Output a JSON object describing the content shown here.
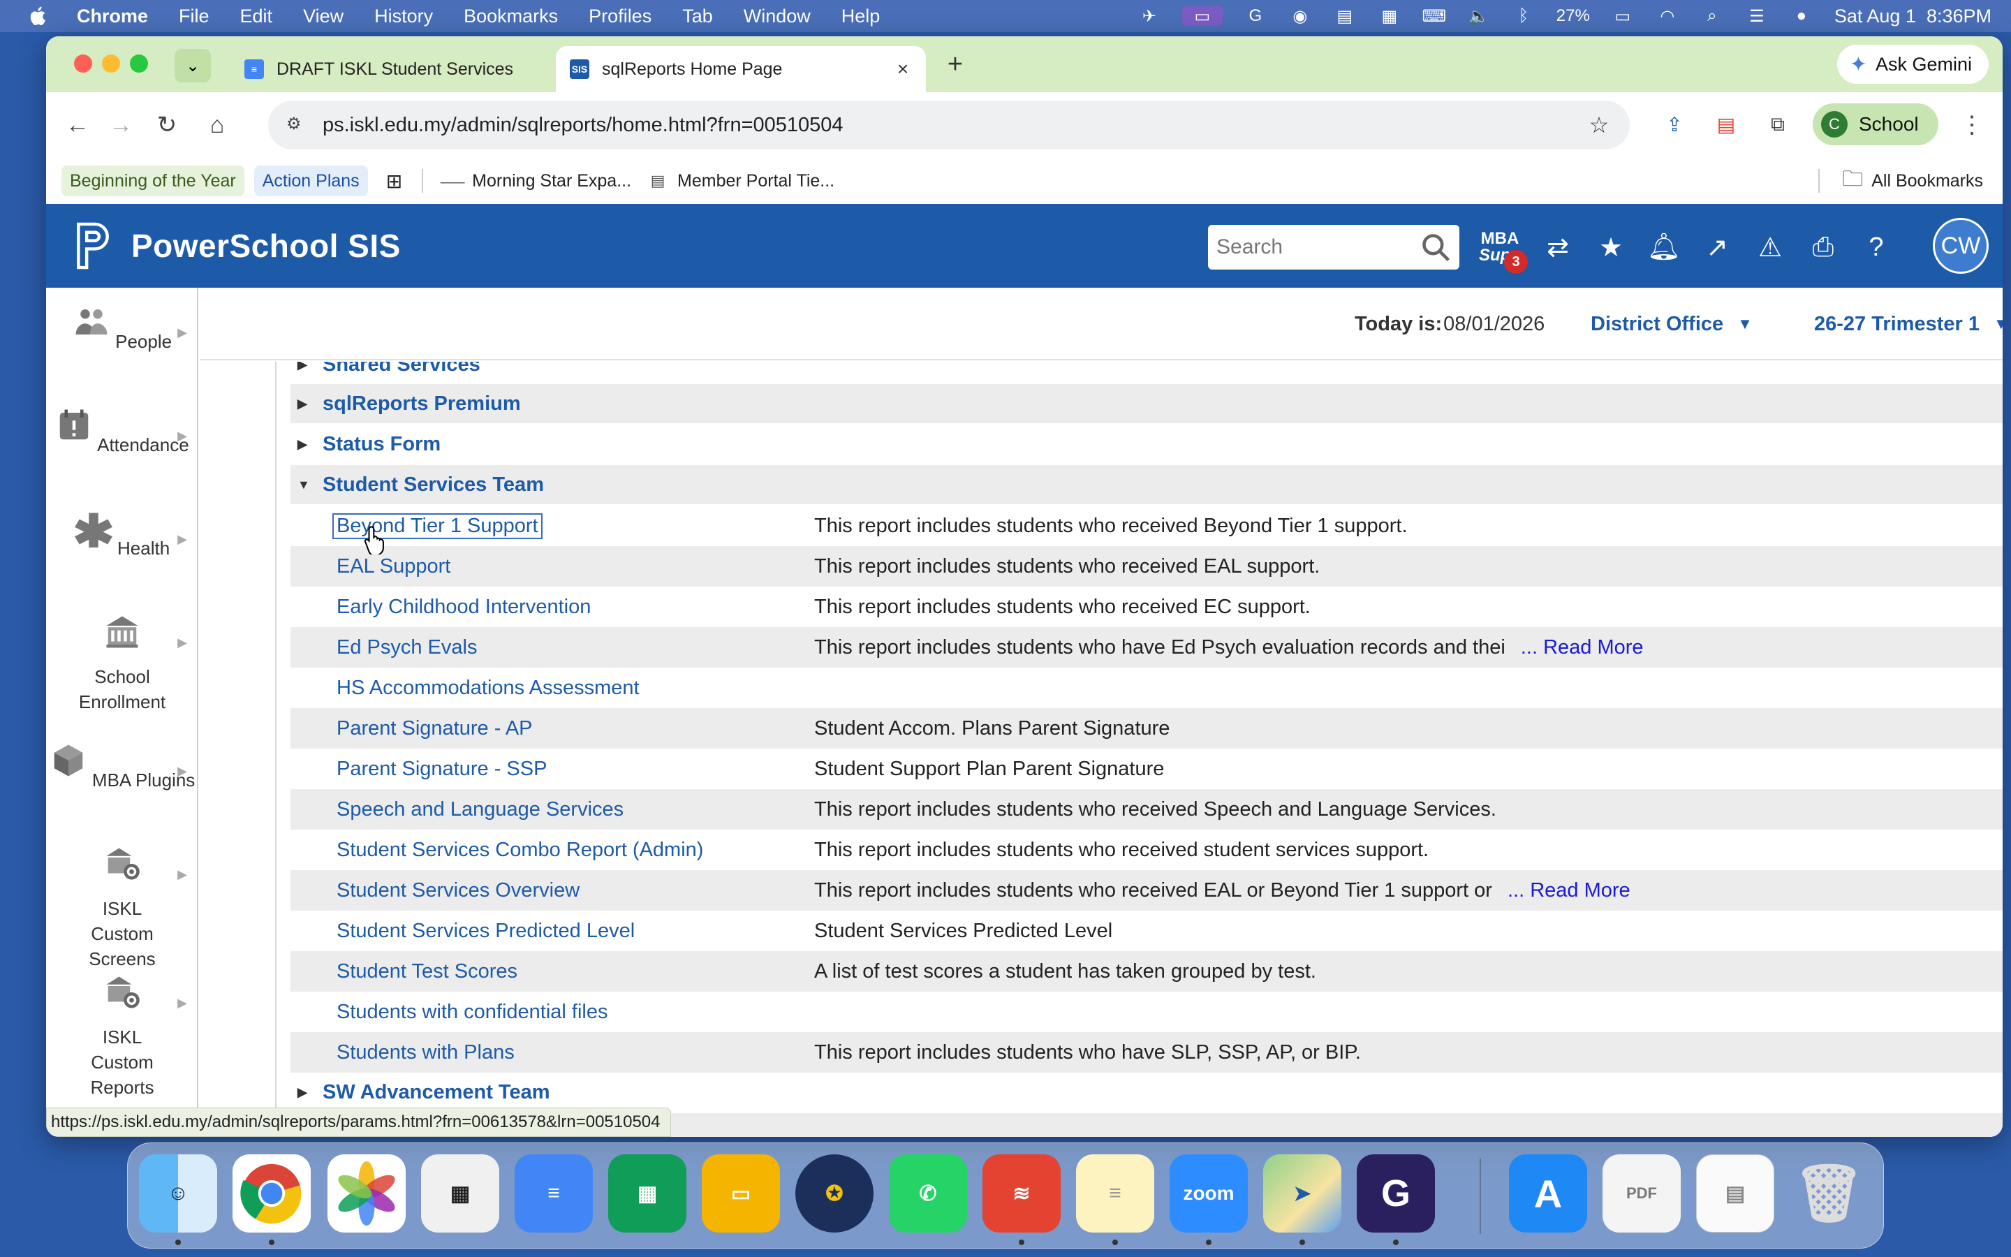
{
  "menubar": {
    "app": "Chrome",
    "items": [
      "File",
      "Edit",
      "View",
      "History",
      "Bookmarks",
      "Profiles",
      "Tab",
      "Window",
      "Help"
    ],
    "battery": "27%",
    "datetime": "Sat Aug 1  8:36PM"
  },
  "browser": {
    "tabs": [
      {
        "title": "DRAFT ISKL Student Services",
        "active": false
      },
      {
        "title": "sqlReports Home Page",
        "active": true
      }
    ],
    "ask_gemini": "Ask Gemini",
    "url": "ps.iskl.edu.my/admin/sqlreports/home.html?frn=00510504",
    "profile_initial": "C",
    "profile_label": "School",
    "bookmarks": [
      "Beginning of the Year",
      "Action Plans",
      "Morning Star Expa...",
      "Member Portal Tie..."
    ],
    "all_bookmarks": "All Bookmarks",
    "status_url": "https://ps.iskl.edu.my/admin/sqlreports/params.html?frn=00613578&lrn=00510504"
  },
  "app": {
    "title": "PowerSchool SIS",
    "search_placeholder": "Search",
    "mba_label_1": "MBA",
    "mba_label_2": "Supp",
    "mba_badge": "3",
    "avatar_initials": "CW",
    "today_label": "Today is:",
    "today_value": "08/01/2026",
    "school": "District Office",
    "term": "26-27 Trimester 1"
  },
  "nav": [
    {
      "label": "People"
    },
    {
      "label": "Attendance"
    },
    {
      "label": "Health"
    },
    {
      "label": "School Enrollment"
    },
    {
      "label": "MBA Plugins"
    },
    {
      "label": "ISKL Custom Screens"
    },
    {
      "label": "ISKL Custom Reports"
    }
  ],
  "groups": {
    "partial": "Shared Services",
    "premium": "sqlReports Premium",
    "status": "Status Form",
    "team": "Student Services Team",
    "advancement": "SW Advancement Team"
  },
  "reports": [
    {
      "name": "Beyond Tier 1 Support",
      "desc": "This report includes students who received Beyond Tier 1 support.",
      "more": ""
    },
    {
      "name": "EAL Support",
      "desc": "This report includes students who received EAL support.",
      "more": ""
    },
    {
      "name": "Early Childhood Intervention",
      "desc": "This report includes students who received EC support.",
      "more": ""
    },
    {
      "name": "Ed Psych Evals",
      "desc": "This report includes students who have Ed Psych evaluation records and thei",
      "more": "... Read More"
    },
    {
      "name": "HS Accommodations Assessment",
      "desc": "",
      "more": ""
    },
    {
      "name": "Parent Signature - AP",
      "desc": "Student Accom. Plans Parent Signature",
      "more": ""
    },
    {
      "name": "Parent Signature - SSP",
      "desc": "Student Support Plan Parent Signature",
      "more": ""
    },
    {
      "name": "Speech and Language Services",
      "desc": "This report includes students who received Speech and Language Services.",
      "more": ""
    },
    {
      "name": "Student Services Combo Report (Admin)",
      "desc": "This report includes students who received student services support.",
      "more": ""
    },
    {
      "name": "Student Services Overview",
      "desc": "This report includes students who received EAL or Beyond Tier 1 support or",
      "more": "... Read More"
    },
    {
      "name": "Student Services Predicted Level",
      "desc": "Student Services Predicted Level",
      "more": ""
    },
    {
      "name": "Student Test Scores",
      "desc": "A list of test scores a student has taken grouped by test.",
      "more": ""
    },
    {
      "name": "Students with confidential files",
      "desc": "",
      "more": ""
    },
    {
      "name": "Students with Plans",
      "desc": "This report includes students who have SLP, SSP, AP, or BIP.",
      "more": ""
    }
  ],
  "dock": {
    "zoom_label": "zoom"
  },
  "colors": {
    "ps_blue": "#1d5aa8",
    "link_blue": "#1d5aa8",
    "read_more": "#1a1ad8",
    "tabstrip": "#d6ecc2"
  }
}
